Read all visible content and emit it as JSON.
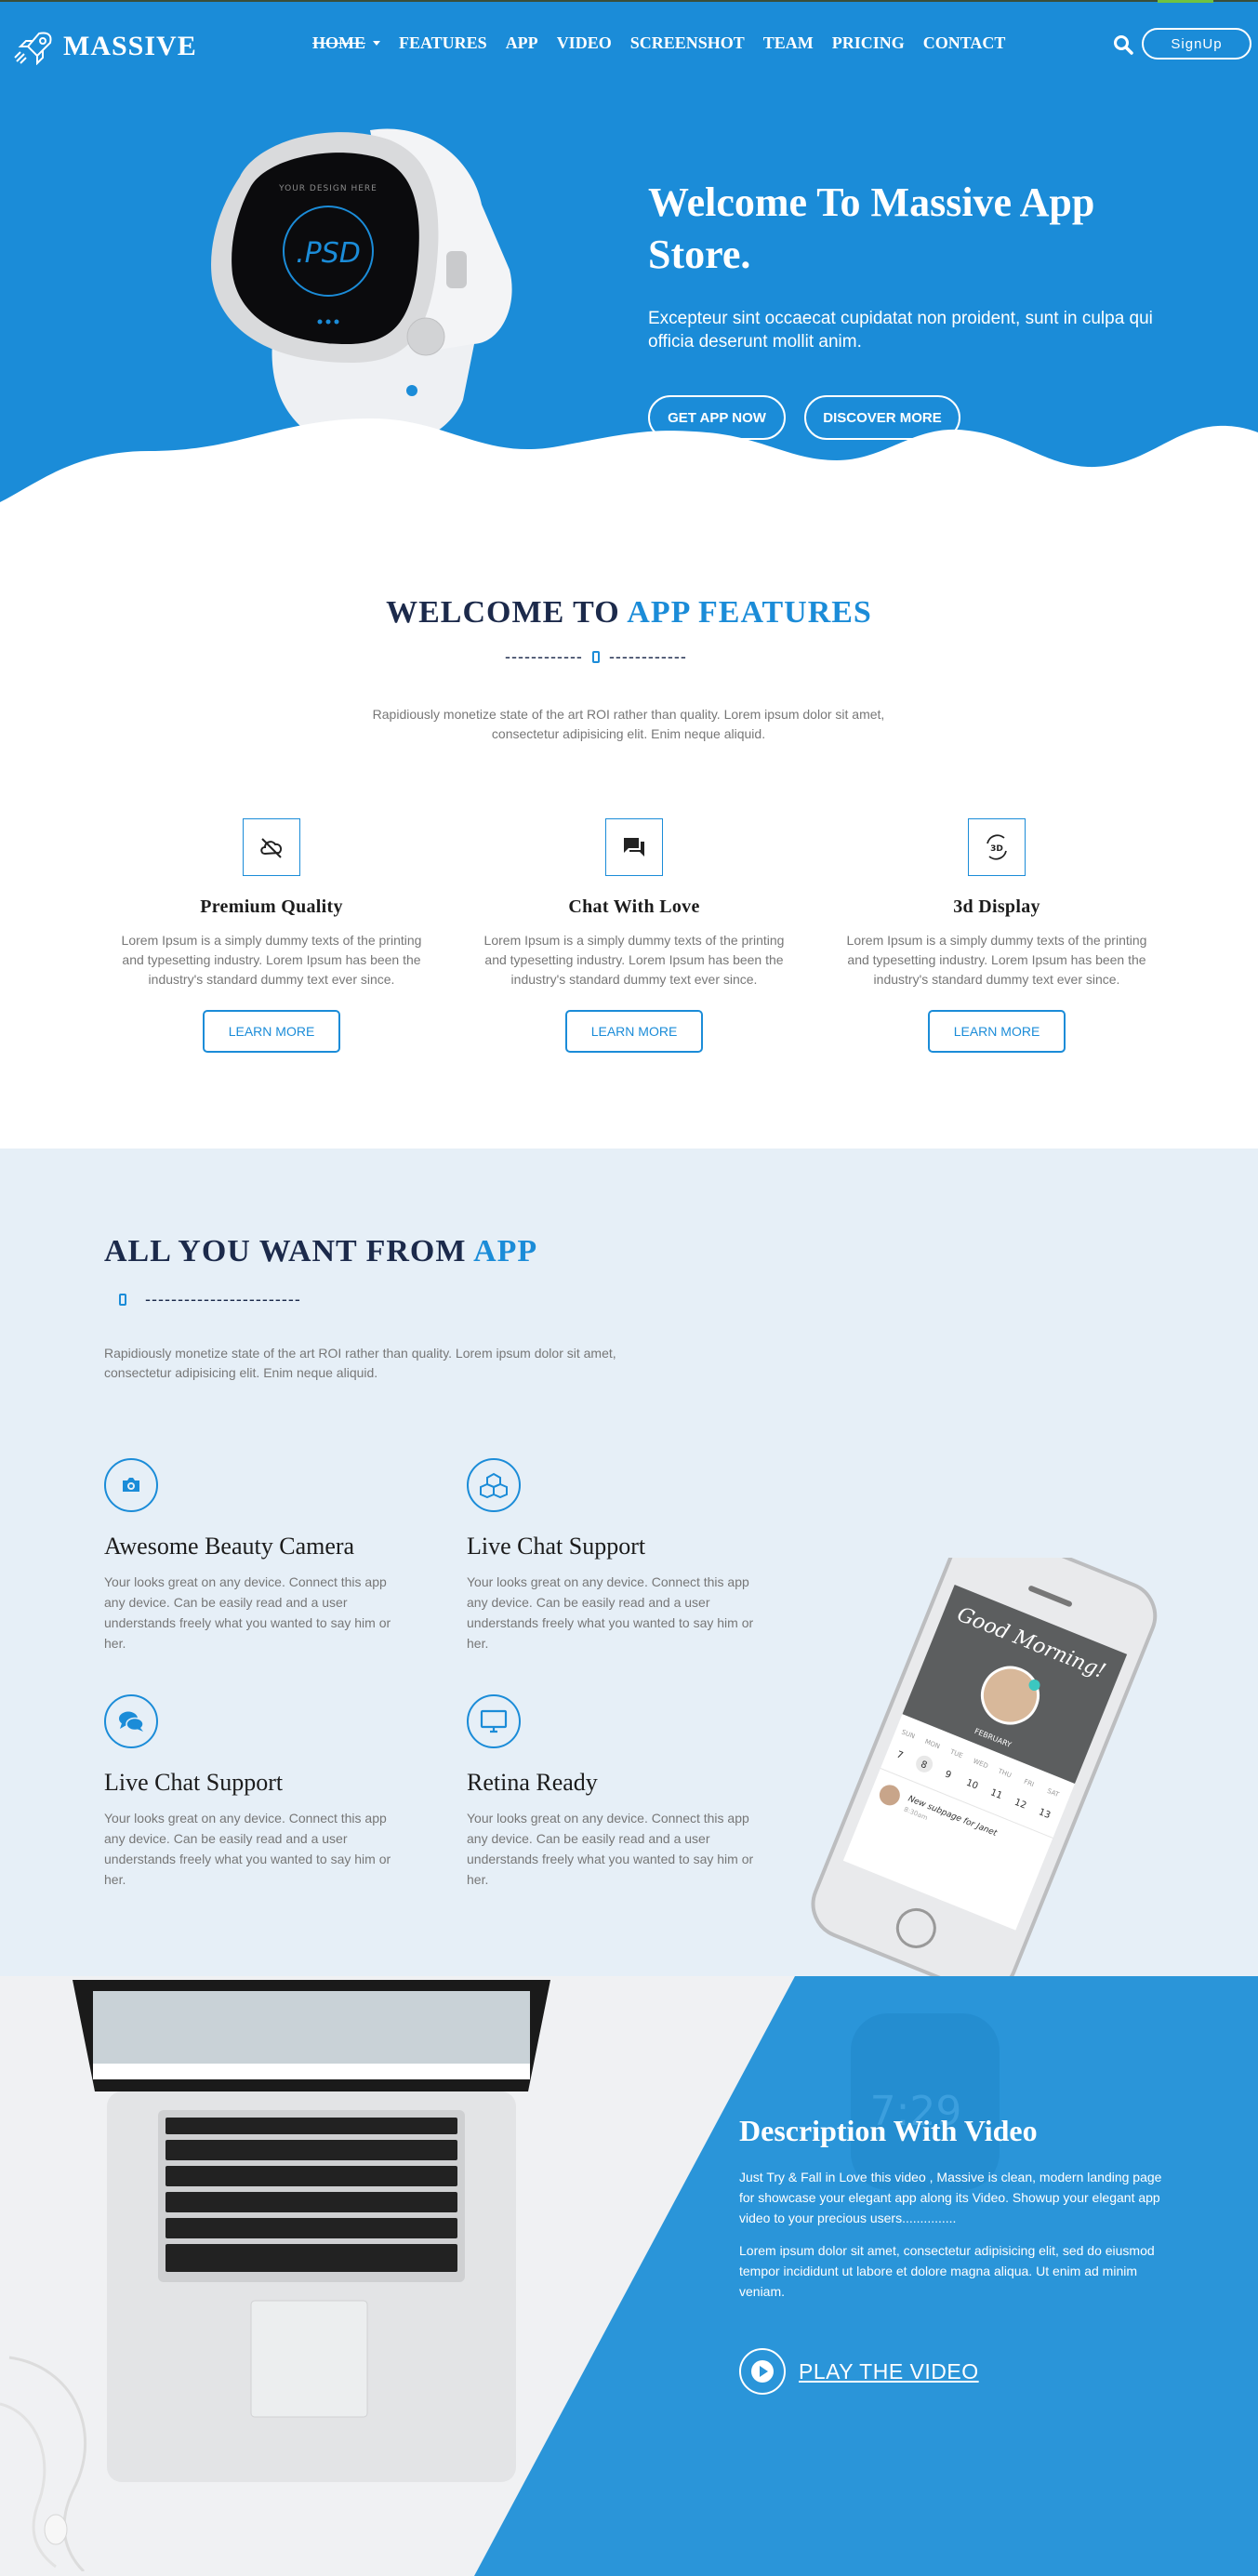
{
  "brand": {
    "name": "MASSIVE",
    "primary": "#1b8cd8",
    "dark": "#1c2a4b"
  },
  "nav": {
    "items": [
      {
        "label": "HOME",
        "active": true
      },
      {
        "label": "FEATURES"
      },
      {
        "label": "APP"
      },
      {
        "label": "VIDEO"
      },
      {
        "label": "SCREENSHOT"
      },
      {
        "label": "TEAM"
      },
      {
        "label": "PRICING"
      },
      {
        "label": "CONTACT"
      }
    ],
    "signup_label": "SignUp"
  },
  "hero": {
    "title": "Welcome To Massive App Store.",
    "subtitle": "Excepteur sint occaecat cupidatat non proident, sunt in culpa qui officia deserunt mollit anim.",
    "watch_text": "YOUR DESIGN HERE",
    "watch_psd": ".PSD",
    "btn_get": "GET APP NOW",
    "btn_discover": "DISCOVER MORE"
  },
  "features": {
    "heading_plain": "WELCOME TO ",
    "heading_accent": "APP FEATURES",
    "divider_left": "------------",
    "divider_right": "------------",
    "description": "Rapidiously monetize state of the art ROI rather than quality. Lorem ipsum dolor sit amet, consectetur adipisicing elit. Enim neque aliquid.",
    "items": [
      {
        "icon": "cloud-off-icon",
        "title": "Premium Quality",
        "text": "Lorem Ipsum is a simply dummy texts of the printing and typesetting industry. Lorem Ipsum has been the industry's standard dummy text ever since.",
        "button": "LEARN MORE"
      },
      {
        "icon": "chat-icon",
        "title": "Chat With Love",
        "text": "Lorem Ipsum is a simply dummy texts of the printing and typesetting industry. Lorem Ipsum has been the industry's standard dummy text ever since.",
        "button": "LEARN MORE"
      },
      {
        "icon": "3d-rotation-icon",
        "title": "3d Display",
        "text": "Lorem Ipsum is a simply dummy texts of the printing and typesetting industry. Lorem Ipsum has been the industry's standard dummy text ever since.",
        "button": "LEARN MORE"
      }
    ]
  },
  "want": {
    "heading_plain": "ALL YOU WANT FROM ",
    "heading_accent": "APP",
    "divider": "------------------------",
    "description": "Rapidiously monetize state of the art ROI rather than quality. Lorem ipsum dolor sit amet, consectetur adipisicing elit. Enim neque aliquid.",
    "items": [
      {
        "icon": "camera-icon",
        "title": "Awesome Beauty Camera",
        "text": "Your looks great on any device. Connect this app any device. Can be easily read and a user understands freely what you wanted to say him or her."
      },
      {
        "icon": "cubes-icon",
        "title": "Live Chat Support",
        "text": "Your looks great on any device. Connect this app any device. Can be easily read and a user understands freely what you wanted to say him or her."
      },
      {
        "icon": "chat-bubbles-icon",
        "title": "Live Chat Support",
        "text": "Your looks great on any device. Connect this app any device. Can be easily read and a user understands freely what you wanted to say him or her."
      },
      {
        "icon": "monitor-icon",
        "title": "Retina Ready",
        "text": "Your looks great on any device. Connect this app any device. Can be easily read and a user understands freely what you wanted to say him or her."
      }
    ],
    "phone": {
      "greeting": "Good Morning!",
      "month": "FEBRUARY",
      "days": [
        "SUN",
        "MON",
        "TUE",
        "WED",
        "THU",
        "FRI",
        "SAT"
      ],
      "dates": [
        "7",
        "8",
        "9",
        "10",
        "11",
        "12",
        "13"
      ],
      "notification": "New subpage for Janet",
      "notification_time": "8:30am"
    }
  },
  "video": {
    "title": "Description With Video",
    "p1": "Just Try & Fall in Love this video , Massive is clean, modern landing page for showcase your elegant app along its Video. Showup your elegant app video to your precious users...............",
    "p2": "Lorem ipsum dolor sit amet, consectetur adipisicing elit, sed do eiusmod tempor incididunt ut labore et dolore magna aliqua. Ut enim ad minim veniam.",
    "play_label": "PLAY THE VIDEO",
    "watch_time": "7:29"
  }
}
